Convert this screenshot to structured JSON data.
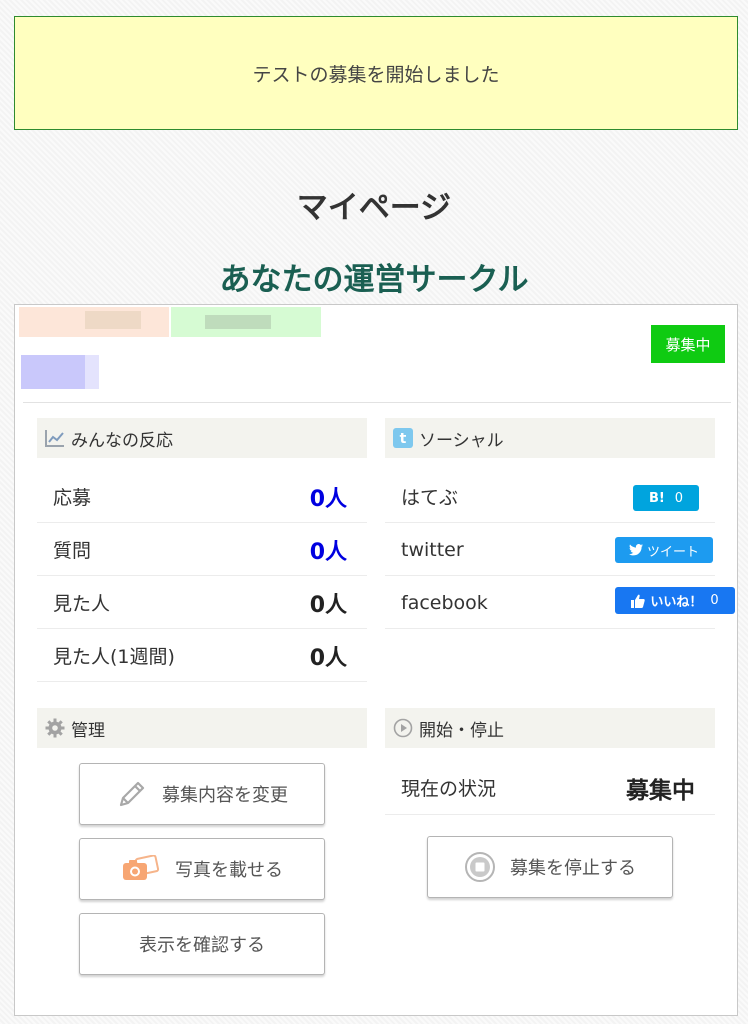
{
  "notice": {
    "message": "テストの募集を開始しました"
  },
  "page_title": "マイページ",
  "section_title": "あなたの運営サークル",
  "circle": {
    "status_badge": "募集中"
  },
  "reactions": {
    "heading": "みんなの反応",
    "icon": "chart-line-icon",
    "rows": [
      {
        "label": "応募",
        "value": "0人"
      },
      {
        "label": "質問",
        "value": "0人"
      },
      {
        "label": "見た人",
        "value": "0人"
      },
      {
        "label": "見た人(1週間)",
        "value": "0人"
      }
    ]
  },
  "social": {
    "heading": "ソーシャル",
    "icon": "tumblr-icon",
    "rows": [
      {
        "label": "はてぶ",
        "button": "B!",
        "count": "0"
      },
      {
        "label": "twitter",
        "button": "ツイート"
      },
      {
        "label": "facebook",
        "button": "いいね！",
        "count": "0"
      }
    ]
  },
  "manage": {
    "heading": "管理",
    "icon": "gear-icon",
    "buttons": [
      {
        "label": "募集内容を変更",
        "icon": "pencil-icon"
      },
      {
        "label": "写真を載せる",
        "icon": "camera-icon"
      },
      {
        "label": "表示を確認する"
      }
    ]
  },
  "start_stop": {
    "heading": "開始・停止",
    "icon": "play-circle-icon",
    "status_label": "現在の状況",
    "status_value": "募集中",
    "stop_button": "募集を停止する",
    "stop_icon": "stop-circle-icon"
  },
  "colors": {
    "notice_bg": "#ffffbf",
    "section_title": "#1a5f52",
    "badge": "#0fcb12",
    "count_blue": "#0000e0",
    "hatebu": "#00a4de",
    "twitter": "#1d9bf0",
    "facebook": "#1877f2"
  }
}
